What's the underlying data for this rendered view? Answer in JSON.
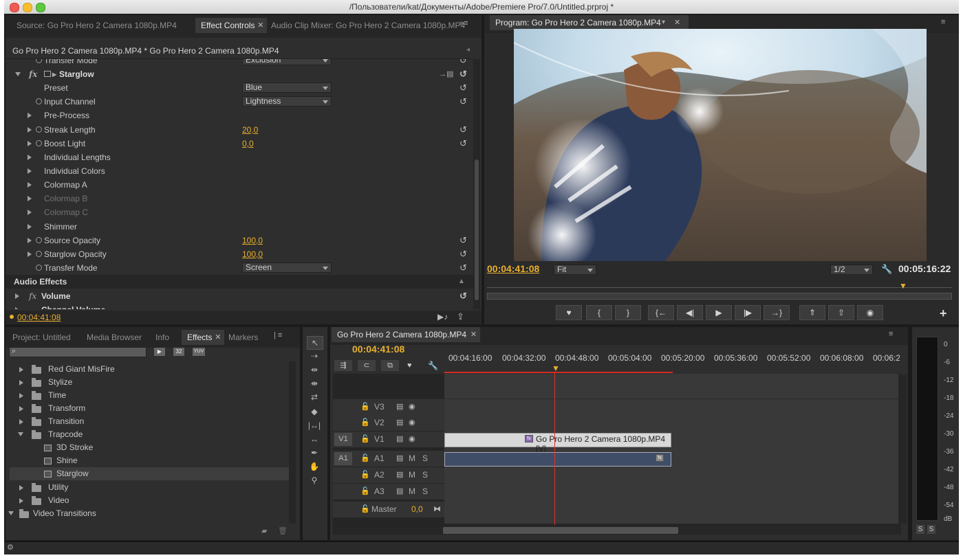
{
  "window": {
    "title": "/Пользователи/kat/Документы/Adobe/Premiere Pro/7.0/Untitled.prproj *"
  },
  "top_left_panel": {
    "tabs": [
      {
        "label": "Source: Go Pro Hero 2 Camera 1080p.MP4"
      },
      {
        "label": "Effect Controls"
      },
      {
        "label": "Audio Clip Mixer: Go Pro Hero 2 Camera 1080p.MP4"
      }
    ],
    "clip_header": "Go Pro Hero 2 Camera 1080p.MP4 * Go Pro Hero 2 Camera 1080p.MP4",
    "rows": {
      "transfer_mode_top": {
        "label": "Transfer Mode",
        "value": "Exclusion"
      },
      "starglow": {
        "label": "Starglow",
        "fx": "fx"
      },
      "preset": {
        "label": "Preset",
        "value": "Blue"
      },
      "input_channel": {
        "label": "Input Channel",
        "value": "Lightness"
      },
      "pre_process": {
        "label": "Pre-Process"
      },
      "streak_length": {
        "label": "Streak Length",
        "value": "20,0"
      },
      "boost_light": {
        "label": "Boost Light",
        "value": "0,0"
      },
      "individual_lengths": {
        "label": "Individual Lengths"
      },
      "individual_colors": {
        "label": "Individual Colors"
      },
      "colormap_a": {
        "label": "Colormap A"
      },
      "colormap_b": {
        "label": "Colormap B"
      },
      "colormap_c": {
        "label": "Colormap C"
      },
      "shimmer": {
        "label": "Shimmer"
      },
      "source_opacity": {
        "label": "Source Opacity",
        "value": "100,0"
      },
      "starglow_opacity": {
        "label": "Starglow Opacity",
        "value": "100,0"
      },
      "transfer_mode": {
        "label": "Transfer Mode",
        "value": "Screen"
      },
      "audio_effects": {
        "label": "Audio Effects"
      },
      "volume": {
        "label": "Volume",
        "fx": "fx"
      },
      "channel_volume": {
        "label": "Channel Volume"
      }
    },
    "timecode": "00:04:41:08"
  },
  "program_monitor": {
    "tab": "Program: Go Pro Hero 2 Camera 1080p.MP4",
    "current_time": "00:04:41:08",
    "zoom": "Fit",
    "resolution": "1/2",
    "duration": "00:05:16:22"
  },
  "project_panel": {
    "tabs": [
      {
        "label": "Project: Untitled"
      },
      {
        "label": "Media Browser"
      },
      {
        "label": "Info"
      },
      {
        "label": "Effects"
      },
      {
        "label": "Markers"
      }
    ],
    "search_placeholder": "",
    "badges": [
      "32",
      "YUV"
    ],
    "tree": [
      {
        "label": "Red Giant MisFire"
      },
      {
        "label": "Stylize"
      },
      {
        "label": "Time"
      },
      {
        "label": "Transform"
      },
      {
        "label": "Transition"
      },
      {
        "label": "Trapcode"
      },
      {
        "label": "3D Stroke"
      },
      {
        "label": "Shine"
      },
      {
        "label": "Starglow"
      },
      {
        "label": "Utility"
      },
      {
        "label": "Video"
      },
      {
        "label": "Video Transitions"
      }
    ]
  },
  "timeline": {
    "tab": "Go Pro Hero 2 Camera 1080p.MP4",
    "timecode": "00:04:41:08",
    "ruler": [
      "00:04:16:00",
      "00:04:32:00",
      "00:04:48:00",
      "00:05:04:00",
      "00:05:20:00",
      "00:05:36:00",
      "00:05:52:00",
      "00:06:08:00",
      "00:06:2"
    ],
    "tracks": [
      {
        "target": "",
        "name": "V3"
      },
      {
        "target": "",
        "name": "V2"
      },
      {
        "target": "V1",
        "name": "V1"
      },
      {
        "target": "A1",
        "name": "A1",
        "m": "M",
        "s": "S"
      },
      {
        "target": "",
        "name": "A2",
        "m": "M",
        "s": "S"
      },
      {
        "target": "",
        "name": "A3",
        "m": "M",
        "s": "S"
      }
    ],
    "master": {
      "label": "Master",
      "value": "0,0"
    },
    "clip_label": "Go Pro Hero 2 Camera 1080p.MP4 [V]",
    "clip_fx": "fx"
  },
  "audio_meter": {
    "scale": [
      "0",
      "-6",
      "-12",
      "-18",
      "-24",
      "-30",
      "-36",
      "-42",
      "-48",
      "-54",
      "dB"
    ],
    "solo_buttons": [
      "S",
      "S"
    ]
  },
  "colors": {
    "timecode": "#e8b030",
    "playhead": "#e0322a",
    "panel": "#2e2e2e",
    "clip_video": "#d8d8d8",
    "clip_audio": "#3f4d66"
  }
}
